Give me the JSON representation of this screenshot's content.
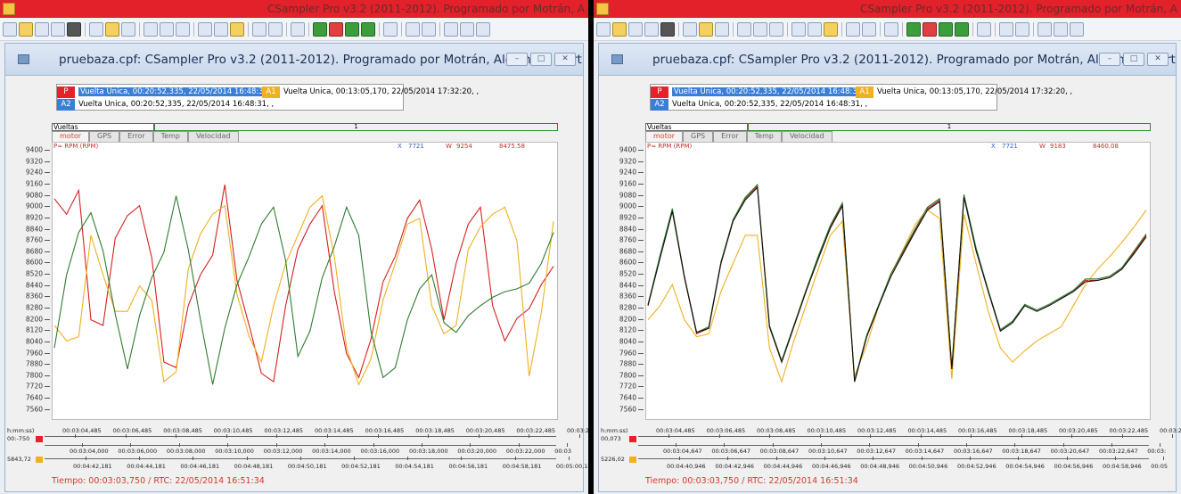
{
  "windows": [
    {
      "app_title": "CSampler Pro v3.2 (2011-2012). Programado por Motrán, A",
      "doc_title": "pruebaza.cpf: CSampler Pro v3.2 (2011-2012). Programado por Motrán, Alejandro Martín.",
      "legend": [
        {
          "tag": "P",
          "tag_color": "#e8202a",
          "text": "Vuelta Unica, 00:20:52,335, 22/05/2014 16:48:31, ."
        },
        {
          "tag": "A1",
          "tag_color": "#f0b020",
          "text": "Vuelta Unica, 00:13:05,170, 22/05/2014 17:32:20, ,"
        },
        {
          "tag": "A2",
          "tag_color": "#3a7fd6",
          "text": "Vuelta Unica, 00:20:52,335, 22/05/2014 16:48:31, ,"
        }
      ],
      "vueltas_label": "Vueltas",
      "vueltas_value": "1",
      "tabs": [
        "motor",
        "GPS",
        "Error",
        "Temp",
        "Velocidad"
      ],
      "readout": {
        "channel": "P≈ RPM (RPM)",
        "x_label": "X",
        "x": "7721",
        "w_label": "W",
        "w": "9254",
        "value": "8475.58"
      },
      "chart_data": {
        "type": "line",
        "ylabel": "",
        "ylim": [
          7520,
          9420
        ],
        "yticks": [
          9400,
          9320,
          9240,
          9160,
          9080,
          9000,
          8920,
          8840,
          8760,
          8680,
          8600,
          8520,
          8440,
          8360,
          8280,
          8200,
          8120,
          8040,
          7960,
          7880,
          7800,
          7720,
          7640,
          7560
        ],
        "series": [
          {
            "color": "#d62020",
            "values": [
              9060,
              8950,
              9120,
              8200,
              8160,
              8780,
              8940,
              9010,
              8640,
              7900,
              7860,
              8300,
              8520,
              8660,
              9160,
              8480,
              8160,
              7820,
              7760,
              8300,
              8700,
              8880,
              9010,
              8400,
              7960,
              7790,
              8060,
              8470,
              8650,
              8920,
              9050,
              8700,
              8200,
              8600,
              8880,
              9000,
              8300,
              8050,
              8210,
              8280,
              8450,
              8580
            ]
          },
          {
            "color": "#f0b020",
            "values": [
              8160,
              8050,
              8080,
              8800,
              8520,
              8260,
              8260,
              8440,
              8340,
              7760,
              7830,
              8560,
              8810,
              8950,
              9010,
              8380,
              8080,
              7900,
              8300,
              8600,
              8800,
              9000,
              9080,
              8650,
              8000,
              7740,
              7920,
              8340,
              8600,
              8880,
              8920,
              8300,
              8100,
              8160,
              8700,
              8860,
              8950,
              9000,
              8760,
              7800,
              8250,
              8900
            ]
          },
          {
            "color": "#2e7d2e",
            "values": [
              8000,
              8520,
              8820,
              8960,
              8690,
              8240,
              7850,
              8230,
              8500,
              8680,
              9080,
              8700,
              8200,
              7740,
              8140,
              8450,
              8650,
              8880,
              9000,
              8620,
              7940,
              8120,
              8500,
              8720,
              9000,
              8800,
              8120,
              7790,
              7860,
              8200,
              8420,
              8520,
              8180,
              8110,
              8230,
              8300,
              8360,
              8400,
              8420,
              8460,
              8600,
              8820
            ]
          }
        ]
      },
      "time_axis": {
        "left_label": "h:mm:ss)",
        "row1_value": "00:-750",
        "row1_labels": [
          "00:03:04,485",
          "00:03:06,485",
          "00:03:08,485",
          "00:03:10,485",
          "00:03:12,485",
          "00:03:14,485",
          "00:03:16,485",
          "00:03:18,485",
          "00:03:20,485",
          "00:03:22,485",
          "00:03:2"
        ],
        "row2_labels": [
          "00:03:04,000",
          "00:03:06,000",
          "00:03:08,000",
          "00:03:10,000",
          "00:03:12,000",
          "00:03:14,000",
          "00:03:16,000",
          "00:03:18,000",
          "00:03:20,000",
          "00:03:22,000",
          "00:03"
        ],
        "row3_value": "5843,72",
        "row3_labels": [
          "00:04:42,181",
          "00:04:44,181",
          "00:04:46,181",
          "00:04:48,181",
          "00:04:50,181",
          "00:04:52,181",
          "00:04:54,181",
          "00:04:56,181",
          "00:04:58,181",
          "00:05:00,181"
        ]
      },
      "footer": "Tiempo: 00:03:03,750  /  RTC: 22/05/2014 16:51:34"
    },
    {
      "app_title": "CSampler Pro v3.2 (2011-2012). Programado por Motrán, A",
      "doc_title": "pruebaza.cpf: CSampler Pro v3.2 (2011-2012). Programado por Motrán, Alejandro Martín.",
      "legend": [
        {
          "tag": "P",
          "tag_color": "#e8202a",
          "text": "Vuelta Unica, 00:20:52,335, 22/05/2014 16:48:31, ."
        },
        {
          "tag": "A1",
          "tag_color": "#f0b020",
          "text": "Vuelta Unica, 00:13:05,170, 22/05/2014 17:32:20, ,"
        },
        {
          "tag": "A2",
          "tag_color": "#3a7fd6",
          "text": "Vuelta Unica, 00:20:52,335, 22/05/2014 16:48:31, ,"
        }
      ],
      "vueltas_label": "Vueltas",
      "vueltas_value": "1",
      "tabs": [
        "motor",
        "GPS",
        "Error",
        "Temp",
        "Velocidad"
      ],
      "readout": {
        "channel": "P≈ RPM (RPM)",
        "x_label": "X",
        "x": "7721",
        "w_label": "W",
        "w": "9183",
        "value": "8460.08"
      },
      "chart_data": {
        "type": "line",
        "ylabel": "",
        "ylim": [
          7520,
          9420
        ],
        "yticks": [
          9400,
          9320,
          9240,
          9160,
          9080,
          9000,
          8920,
          8840,
          8760,
          8680,
          8600,
          8520,
          8440,
          8360,
          8280,
          8200,
          8120,
          8040,
          7960,
          7880,
          7800,
          7720,
          7640,
          7560
        ],
        "series": [
          {
            "color": "#d62020",
            "values": [
              8300,
              8650,
              8980,
              8500,
              8100,
              8140,
              8600,
              8900,
              9060,
              9150,
              8150,
              7900,
              8150,
              8400,
              8640,
              8860,
              9020,
              7760,
              8080,
              8300,
              8520,
              8680,
              8840,
              8990,
              9050,
              7850,
              9080,
              8700,
              8400,
              8120,
              8180,
              8300,
              8260,
              8300,
              8350,
              8400,
              8480,
              8480,
              8500,
              8560,
              8680,
              8800
            ]
          },
          {
            "color": "#f0b020",
            "values": [
              8200,
              8300,
              8450,
              8200,
              8080,
              8100,
              8400,
              8600,
              8800,
              8800,
              8000,
              7760,
              8050,
              8300,
              8560,
              8800,
              8900,
              7800,
              8020,
              8300,
              8520,
              8700,
              8880,
              8980,
              8920,
              7780,
              8950,
              8600,
              8260,
              8000,
              7900,
              7980,
              8050,
              8100,
              8150,
              8300,
              8450,
              8560,
              8650,
              8750,
              8860,
              8980
            ]
          },
          {
            "color": "#2e7d2e",
            "values": [
              8310,
              8660,
              8990,
              8510,
              8110,
              8150,
              8610,
              8910,
              9070,
              9160,
              8160,
              7910,
              8160,
              8410,
              8650,
              8870,
              9030,
              7770,
              8090,
              8310,
              8530,
              8690,
              8850,
              9000,
              9060,
              7860,
              9090,
              8710,
              8410,
              8130,
              8190,
              8310,
              8270,
              8310,
              8360,
              8410,
              8490,
              8490,
              8510,
              8570,
              8690,
              8810
            ]
          },
          {
            "color": "#111111",
            "values": [
              8300,
              8640,
              8970,
              8500,
              8110,
              8140,
              8600,
              8900,
              9050,
              9140,
              8150,
              7900,
              8150,
              8400,
              8630,
              8850,
              9010,
              7760,
              8080,
              8300,
              8510,
              8670,
              8830,
              8980,
              9040,
              7850,
              9070,
              8690,
              8400,
              8120,
              8180,
              8300,
              8260,
              8300,
              8350,
              8400,
              8470,
              8480,
              8500,
              8560,
              8670,
              8790
            ]
          }
        ]
      },
      "time_axis": {
        "left_label": "h:mm:ss)",
        "row1_value": "00,073",
        "row1_labels": [
          "00:03:04,485",
          "00:03:06,485",
          "00:03:08,485",
          "00:03:10,485",
          "00:03:12,485",
          "00:03:14,485",
          "00:03:16,485",
          "00:03:18,485",
          "00:03:20,485",
          "00:03:22,485",
          "00:03:2"
        ],
        "row2_labels": [
          "00:03:04,647",
          "00:03:06,647",
          "00:03:08,647",
          "00:03:10,647",
          "00:03:12,647",
          "00:03:14,647",
          "00:03:16,647",
          "00:03:18,647",
          "00:03:20,647",
          "00:03:22,647",
          "00:03:"
        ],
        "row3_value": "5226,02",
        "row3_labels": [
          "00:04:40,946",
          "00:04:42,946",
          "00:04:44,946",
          "00:04:46,946",
          "00:04:48,946",
          "00:04:50,946",
          "00:04:52,946",
          "00:04:54,946",
          "00:04:56,946",
          "00:04:58,946",
          "00:05"
        ]
      },
      "footer": "Tiempo: 00:03:03,750  /  RTC: 22/05/2014 16:51:34"
    }
  ]
}
